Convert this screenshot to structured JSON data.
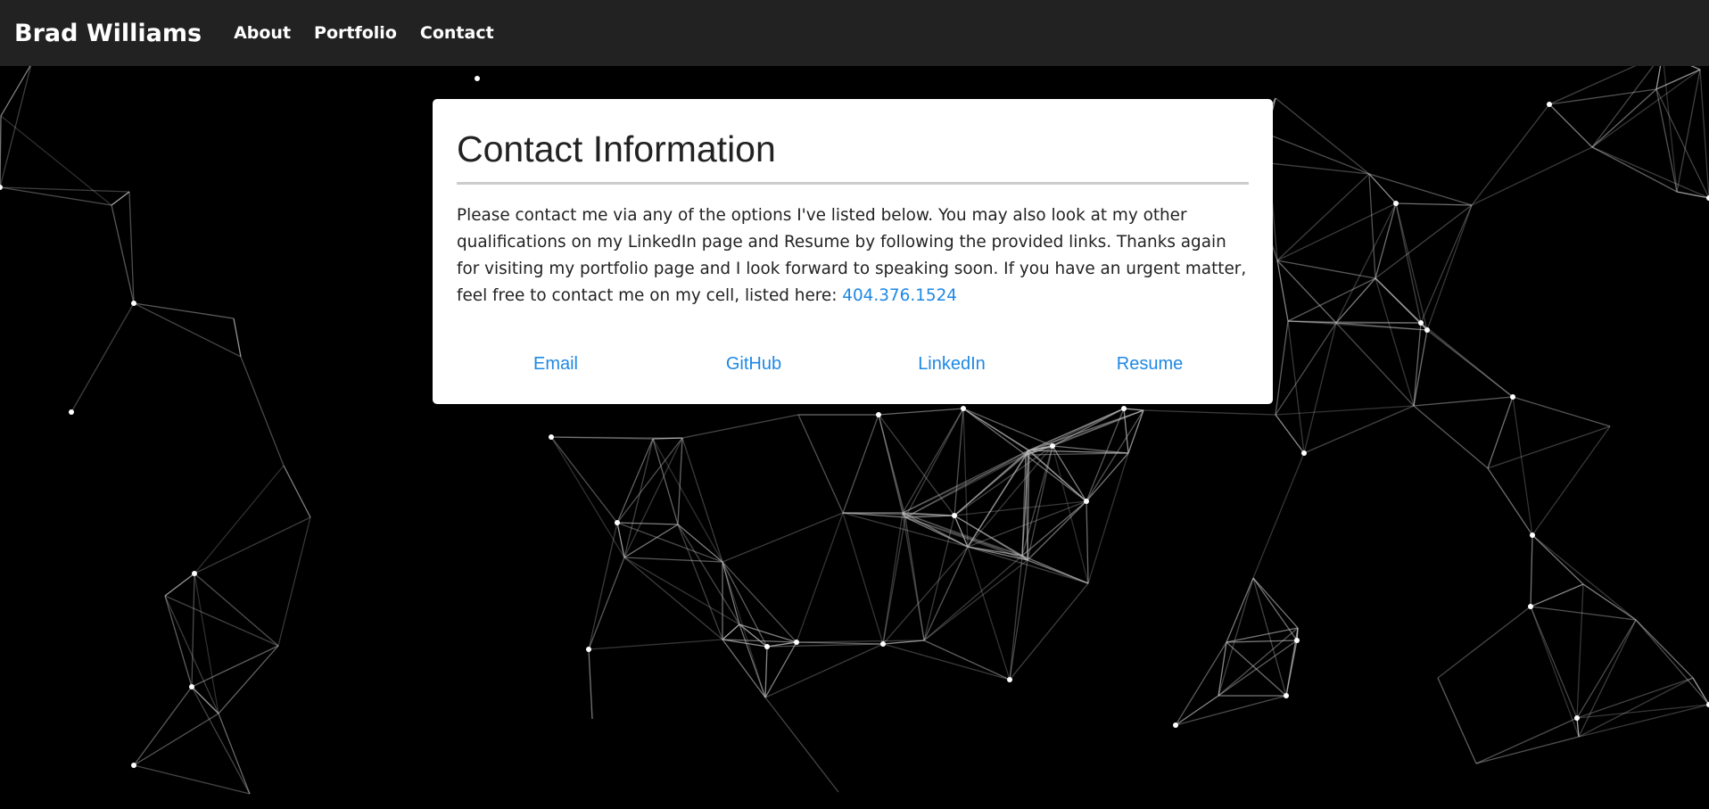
{
  "nav": {
    "brand": "Brad Williams",
    "items": [
      {
        "label": "About"
      },
      {
        "label": "Portfolio"
      },
      {
        "label": "Contact"
      }
    ]
  },
  "contact": {
    "title": "Contact Information",
    "body": "Please contact me via any of the options I've listed below. You may also look at my other qualifications on my LinkedIn page and Resume by following the provided links. Thanks again for visiting my portfolio page and I look forward to speaking soon. If you have an urgent matter, feel free to contact me on my cell, listed here: ",
    "phone": "404.376.1524",
    "links": [
      {
        "label": "Email"
      },
      {
        "label": "GitHub"
      },
      {
        "label": "LinkedIn"
      },
      {
        "label": "Resume"
      }
    ]
  },
  "colors": {
    "navbar": "#222222",
    "background": "#000000",
    "link": "#1e88e5",
    "network_lines": "#bbbbbb"
  }
}
